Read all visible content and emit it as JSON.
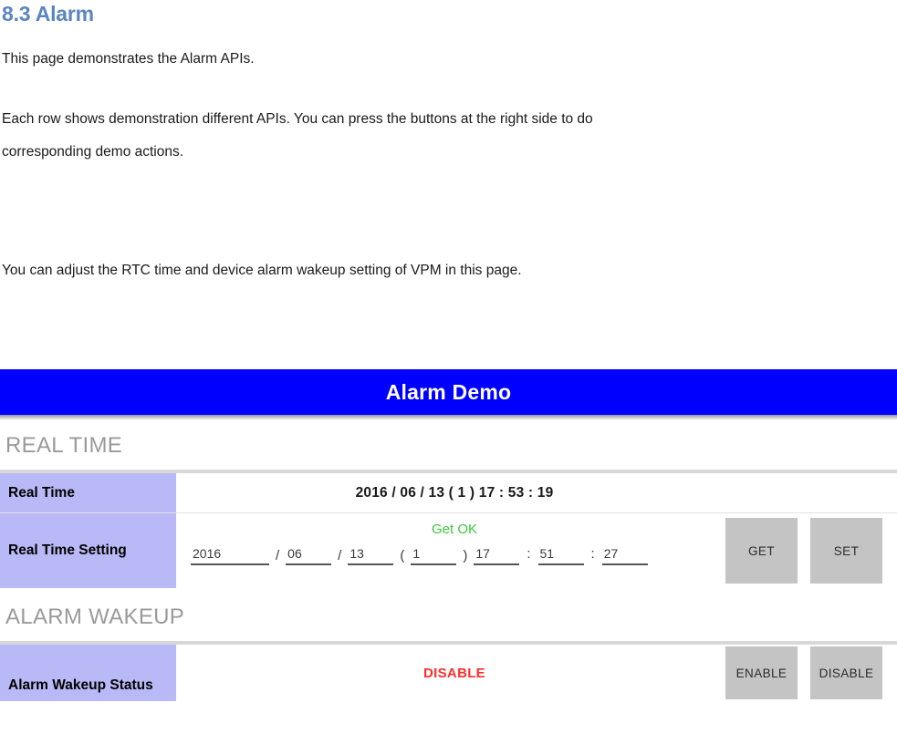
{
  "document": {
    "heading": "8.3 Alarm",
    "paragraph1": "This page demonstrates the Alarm APIs.",
    "paragraph2a": "Each row shows demonstration different APIs. You can press the buttons at the right side to do",
    "paragraph2b": "corresponding demo actions.",
    "paragraph3": "You can adjust the RTC time and device alarm wakeup setting of VPM in this page."
  },
  "app": {
    "title": "Alarm Demo",
    "title_bg": "#0000ff",
    "sections": [
      {
        "label": "REAL TIME",
        "rows": [
          {
            "label": "Real Time",
            "value": "2016 / 06 / 13 ( 1 )  17 : 53 : 19"
          },
          {
            "label": "Real Time Setting",
            "status": "Get OK",
            "status_color": "#3fc73f",
            "fields": {
              "year": "2016",
              "month": "06",
              "day": "13",
              "weekday": "1",
              "hour": "17",
              "minute": "51",
              "second": "27"
            },
            "separators": {
              "date_slash": "/",
              "paren_open": "(",
              "paren_close": ")",
              "time_colon": ":"
            },
            "buttons": [
              {
                "label": "GET"
              },
              {
                "label": "SET"
              }
            ]
          }
        ]
      },
      {
        "label": "ALARM WAKEUP",
        "rows": [
          {
            "label": "Alarm Wakeup Status",
            "value": "DISABLE",
            "value_color": "#ff2d2d",
            "buttons": [
              {
                "label": "ENABLE"
              },
              {
                "label": "DISABLE"
              }
            ]
          }
        ]
      }
    ]
  }
}
